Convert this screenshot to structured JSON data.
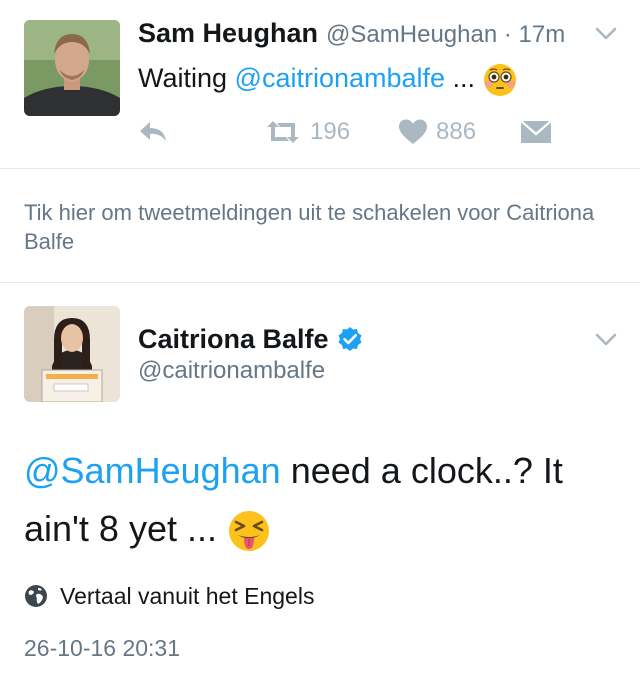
{
  "tweet1": {
    "author_name": "Sam Heughan",
    "handle_time": "@SamHeughan · 17m",
    "text_prefix": "Waiting ",
    "mention": "@caitrionambalfe",
    "text_suffix": " ...",
    "emoji": "flushed-face",
    "retweet_count": "196",
    "like_count": "886"
  },
  "notification": {
    "text": "Tik hier om tweetmeldingen uit te schakelen voor Caitriona Balfe"
  },
  "tweet2": {
    "author_name": "Caitriona Balfe",
    "handle": "@caitrionambalfe",
    "mention": "@SamHeughan",
    "text": " need a clock..? It ain't 8 yet ...",
    "emoji": "squinting-tongue-face",
    "translate_label": "Vertaal vanuit het Engels",
    "timestamp": "26-10-16 20:31"
  },
  "colors": {
    "accent": "#1da1f2",
    "muted": "#657786",
    "icon": "#aab8c2",
    "divider": "#e1e8ed"
  }
}
